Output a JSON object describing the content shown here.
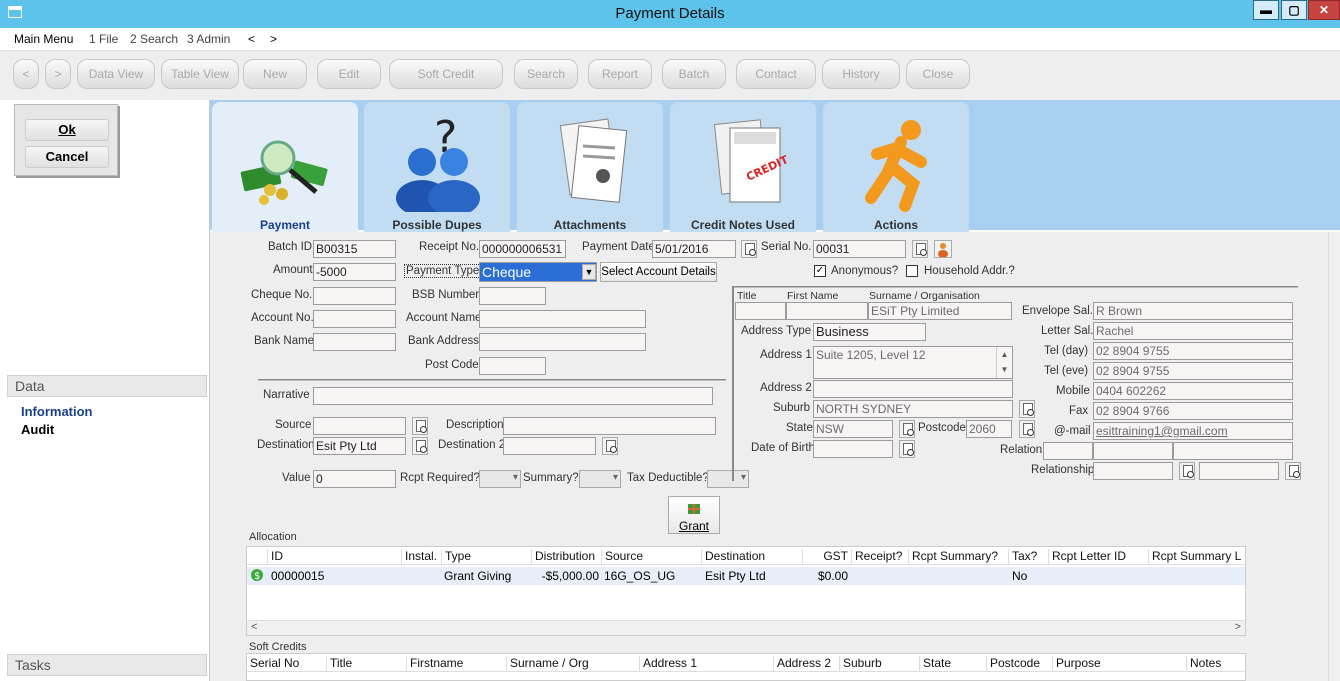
{
  "window": {
    "title": "Payment Details",
    "min": "▬",
    "max": "▢",
    "close": "✕"
  },
  "menu": [
    "Main Menu",
    "1 File",
    "2 Search",
    "3 Admin",
    "<",
    ">"
  ],
  "toolbar": [
    "<",
    ">",
    "Data View",
    "Table View",
    "New",
    "Edit",
    "Soft Credit",
    "Search",
    "Report",
    "Batch",
    "Contact",
    "History",
    "Close"
  ],
  "left": {
    "ok": "Ok",
    "cancel": "Cancel",
    "data_header": "Data",
    "data_items": [
      "Information",
      "Audit"
    ],
    "tasks_header": "Tasks"
  },
  "tabs": [
    "Payment",
    "Possible Dupes",
    "Attachments",
    "Credit Notes Used",
    "Actions"
  ],
  "form": {
    "batch_id_label": "Batch ID",
    "batch_id": "B00315",
    "receipt_no_label": "Receipt No.",
    "receipt_no": "000000006531",
    "payment_date_label": "Payment Date",
    "payment_date": "5/01/2016",
    "serial_no_label": "Serial No.",
    "serial_no": "00031",
    "amount_label": "Amount",
    "amount": "-5000",
    "payment_type_label": "Payment Type",
    "payment_type": "Cheque",
    "select_account_details": "Select Account Details",
    "anonymous_label": "Anonymous?",
    "household_label": "Household Addr.?",
    "cheque_no_label": "Cheque No.",
    "bsb_label": "BSB Number",
    "account_no_label": "Account No.",
    "account_name_label": "Account Name",
    "bank_name_label": "Bank Name",
    "bank_address_label": "Bank Address",
    "post_code_label": "Post Code",
    "narrative_label": "Narrative",
    "source_label": "Source",
    "description_label": "Description",
    "destination_label": "Destination",
    "destination": "Esit Pty Ltd",
    "destination2_label": "Destination 2",
    "value_label": "Value",
    "value": "0",
    "rcpt_required_label": "Rcpt Required?",
    "summary_label": "Summary?",
    "tax_deductible_label": "Tax Deductible?",
    "grant_button": "Grant"
  },
  "contact": {
    "title_label": "Title",
    "first_name_label": "First Name",
    "surname_label": "Surname / Organisation",
    "surname": "ESiT Pty Limited",
    "address_type_label": "Address Type",
    "address_type": "Business",
    "address1_label": "Address 1",
    "address1": "Suite 1205, Level 12",
    "address2_label": "Address 2",
    "suburb_label": "Suburb",
    "suburb": "NORTH SYDNEY",
    "state_label": "State",
    "state": "NSW",
    "postcode_label": "Postcode",
    "postcode": "2060",
    "dob_label": "Date of Birth",
    "envelope_sal_label": "Envelope Sal.",
    "envelope_sal": "R Brown",
    "letter_sal_label": "Letter Sal.",
    "letter_sal": "Rachel",
    "tel_day_label": "Tel (day)",
    "tel_day": "02 8904 9755",
    "tel_eve_label": "Tel (eve)",
    "tel_eve": "02 8904 9755",
    "mobile_label": "Mobile",
    "mobile": "0404 602262",
    "fax_label": "Fax",
    "fax": "02 8904 9766",
    "email_label": "@-mail",
    "email": "esittraining1@gmail.com",
    "relation_label": "Relation",
    "relationship_label": "Relationship"
  },
  "allocation": {
    "label": "Allocation",
    "headers": [
      "ID",
      "Instal.",
      "Type",
      "Distribution",
      "Source",
      "Destination",
      "GST",
      "Receipt?",
      "Rcpt Summary?",
      "Tax?",
      "Rcpt Letter ID",
      "Rcpt Summary L"
    ],
    "row": {
      "id": "00000015",
      "type": "Grant Giving",
      "distribution": "-$5,000.00",
      "source": "16G_OS_UG",
      "destination": "Esit Pty Ltd",
      "gst": "$0.00",
      "tax": "No"
    }
  },
  "soft_credits": {
    "label": "Soft Credits",
    "headers": [
      "Serial No",
      "Title",
      "Firstname",
      "Surname / Org",
      "Address 1",
      "Address 2",
      "Suburb",
      "State",
      "Postcode",
      "Purpose",
      "Notes"
    ]
  }
}
